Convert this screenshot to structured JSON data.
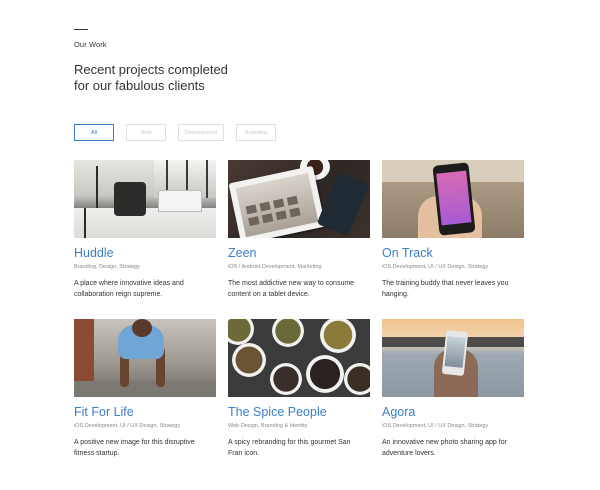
{
  "header": {
    "eyebrow": "Our Work",
    "headline_line1": "Recent projects completed",
    "headline_line2": "for our fabulous clients"
  },
  "filters": [
    {
      "label": "All",
      "active": true
    },
    {
      "label": "Web",
      "active": false
    },
    {
      "label": "Development",
      "active": false
    },
    {
      "label": "Branding",
      "active": false
    }
  ],
  "projects": [
    {
      "title": "Huddle",
      "tags": "Branding, Design, Strategy",
      "description": "A place where innovative ideas and collaboration reign supreme.",
      "thumbnail": "office-workspace-photo"
    },
    {
      "title": "Zeen",
      "tags": "iOS / Android Development, Marketing",
      "description": "The most addictive new way to consume content on a tablet device.",
      "thumbnail": "tablet-on-table-photo"
    },
    {
      "title": "On Track",
      "tags": "iOS Development, UI / UX Design, Strategy",
      "description": "The training buddy that never leaves you hanging.",
      "thumbnail": "hand-holding-phone-photo"
    },
    {
      "title": "Fit For Life",
      "tags": "iOS Development, UI / UX Design, Strategy",
      "description": "A positive new image for this disruptive fitness startup.",
      "thumbnail": "pushup-athlete-photo"
    },
    {
      "title": "The Spice People",
      "tags": "Web Design, Branding & Identity",
      "description": "A spicy rebranding for this gourmet San Fran icon.",
      "thumbnail": "spice-bowls-photo"
    },
    {
      "title": "Agora",
      "tags": "iOS Development, UI / UX Design, Strategy",
      "description": "An innovative new photo sharing app for adventure lovers.",
      "thumbnail": "phone-at-lake-photo"
    }
  ],
  "colors": {
    "accent": "#3a7fc4",
    "text": "#333333",
    "muted": "#888888",
    "border": "#e0e0e0"
  }
}
